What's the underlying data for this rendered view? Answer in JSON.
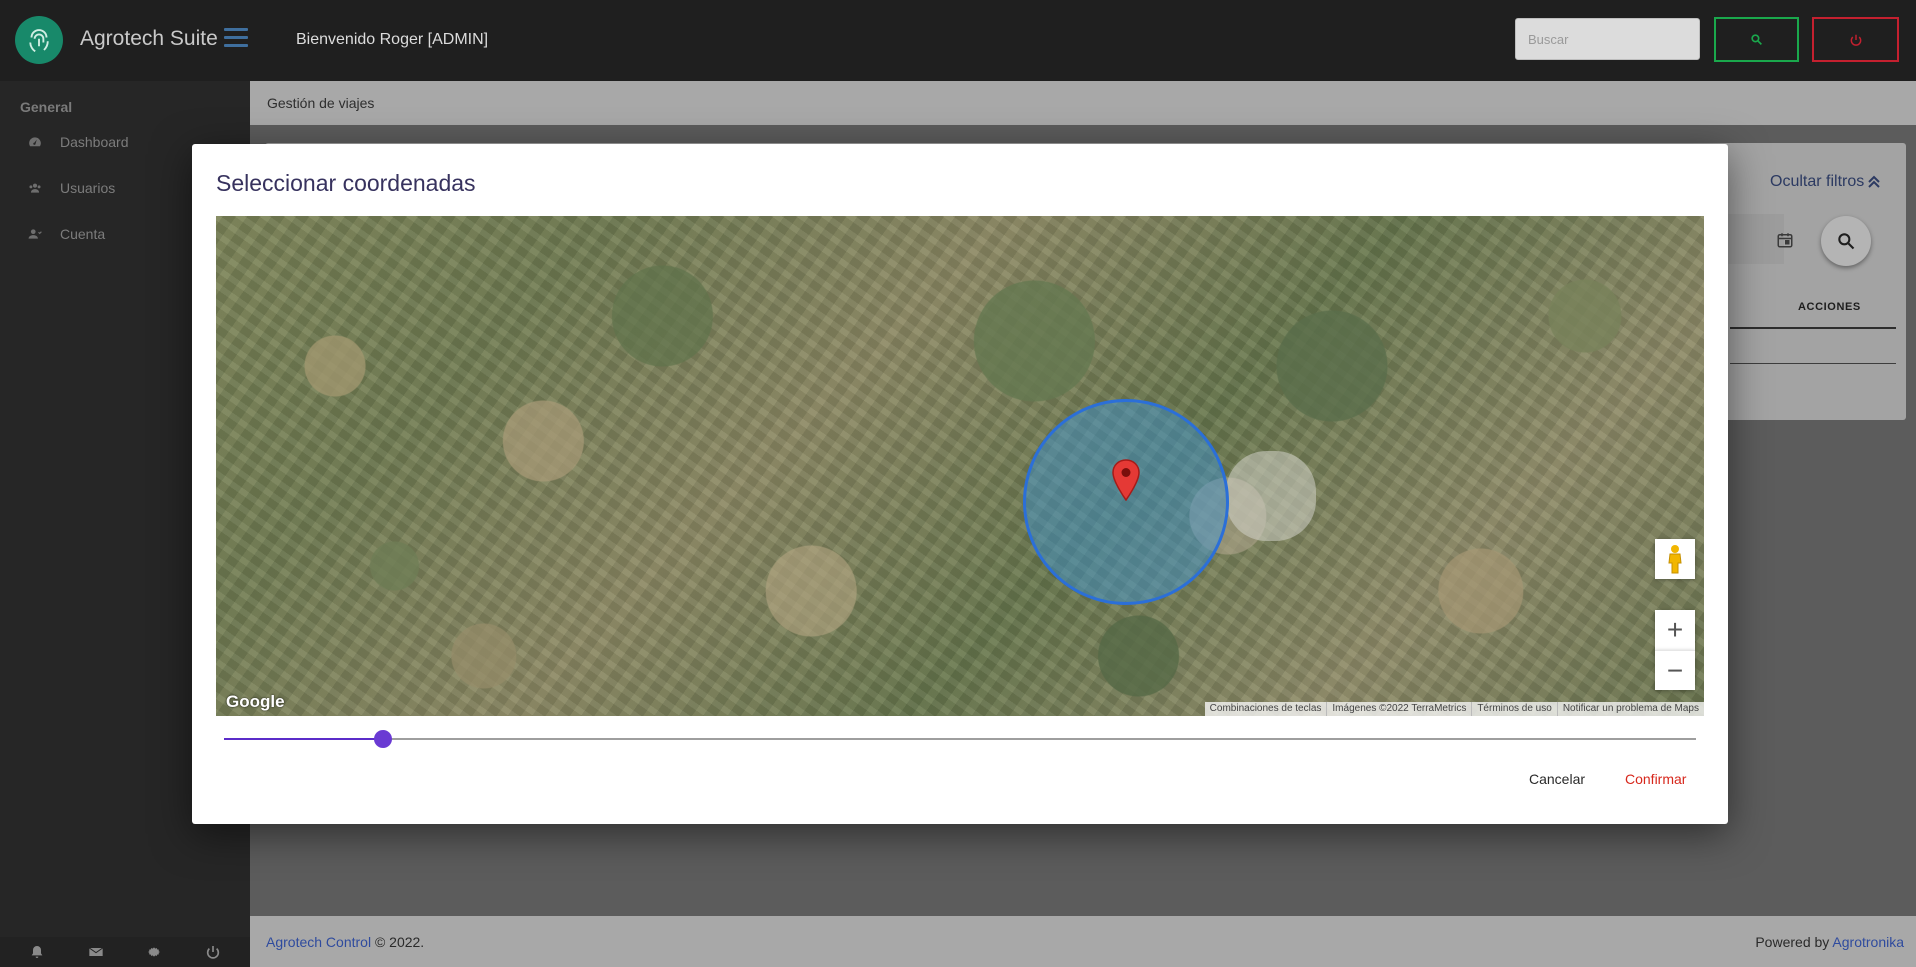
{
  "header": {
    "app_title": "Agrotech Suite",
    "welcome": "Bienvenido Roger [ADMIN]",
    "search_placeholder": "Buscar"
  },
  "sidebar": {
    "section": "General",
    "items": [
      {
        "label": "Dashboard",
        "icon": "dashboard-icon"
      },
      {
        "label": "Usuarios",
        "icon": "users-icon"
      },
      {
        "label": "Cuenta",
        "icon": "account-icon"
      }
    ],
    "bottom_icons": [
      "bell-icon",
      "mail-icon",
      "gear-icon",
      "power-icon"
    ]
  },
  "main": {
    "breadcrumb": "Gestión de viajes",
    "filter_toggle": "Ocultar filtros",
    "table_header_actions": "ACCIONES"
  },
  "footer": {
    "left_link": "Agrotech Control",
    "left_text": " © 2022.",
    "right_text": "Powered by ",
    "right_link": "Agrotronika"
  },
  "modal": {
    "title": "Seleccionar coordenadas",
    "map": {
      "google_logo": "Google",
      "attribution": [
        "Combinaciones de teclas",
        "Imágenes ©2022 TerraMetrics",
        "Términos de uso",
        "Notificar un problema de Maps"
      ],
      "zoom_in": "+",
      "zoom_out": "−"
    },
    "slider_value_fraction": 0.108,
    "cancel_label": "Cancelar",
    "confirm_label": "Confirmar"
  },
  "colors": {
    "brand_green": "#18896a",
    "search_button_border": "#1aa84c",
    "power_button_border": "#c4202f",
    "slider_accent": "#6a3ad3",
    "confirm_red": "#d7271c",
    "circle_blue": "#2b6fd8"
  }
}
